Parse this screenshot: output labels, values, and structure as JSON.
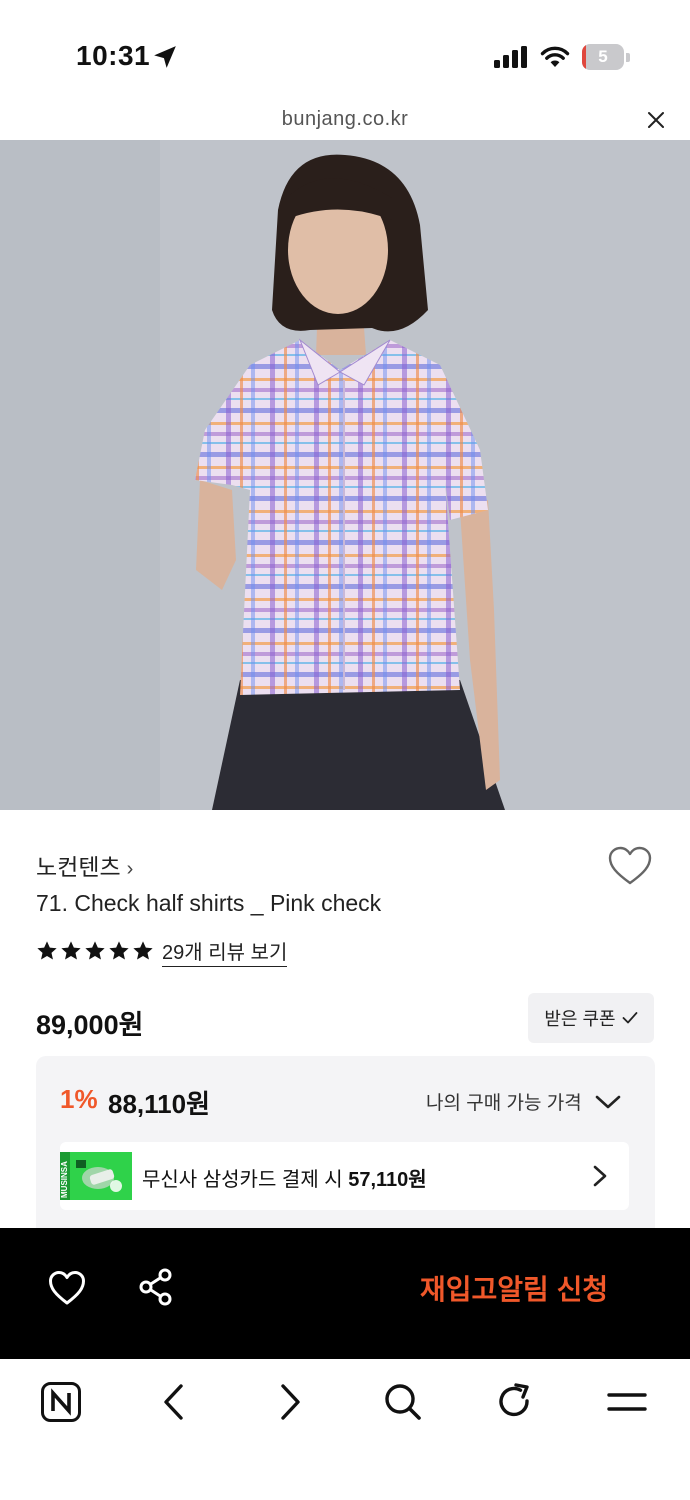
{
  "status_bar": {
    "time": "10:31",
    "battery_level": "5",
    "battery_fraction": 0.08,
    "icons": [
      "location-arrow-icon",
      "cellular-signal-icon",
      "wifi-icon",
      "battery-icon"
    ]
  },
  "browser": {
    "url": "bunjang.co.kr",
    "close_icon": "close-icon"
  },
  "product": {
    "brand": "노컨텐츠",
    "brand_chevron": "›",
    "title": "71. Check half shirts _ Pink check",
    "stars": 5,
    "review_link": "29개 리뷰 보기",
    "price": "89,000원",
    "coupon_label": "받은 쿠폰",
    "discount_rate": "1%",
    "discount_price": "88,110원",
    "my_price_label": "나의 구매 가능 가격",
    "card_promo": {
      "text": "무신사 삼성카드 결제 시",
      "price": "57,110원",
      "thumb_label": "MUSINSA"
    }
  },
  "action_bar": {
    "restock_label": "재입고알림 신청",
    "icons": [
      "heart-icon",
      "share-icon"
    ]
  },
  "toolbar": {
    "icons": [
      "naver-home-icon",
      "back-icon",
      "forward-icon",
      "search-icon",
      "reload-icon",
      "menu-icon"
    ]
  },
  "colors": {
    "accent": "#f0582a",
    "action_bar_bg": "#000000",
    "card_bg": "#f4f4f6",
    "promo_green": "#2fd24a"
  }
}
